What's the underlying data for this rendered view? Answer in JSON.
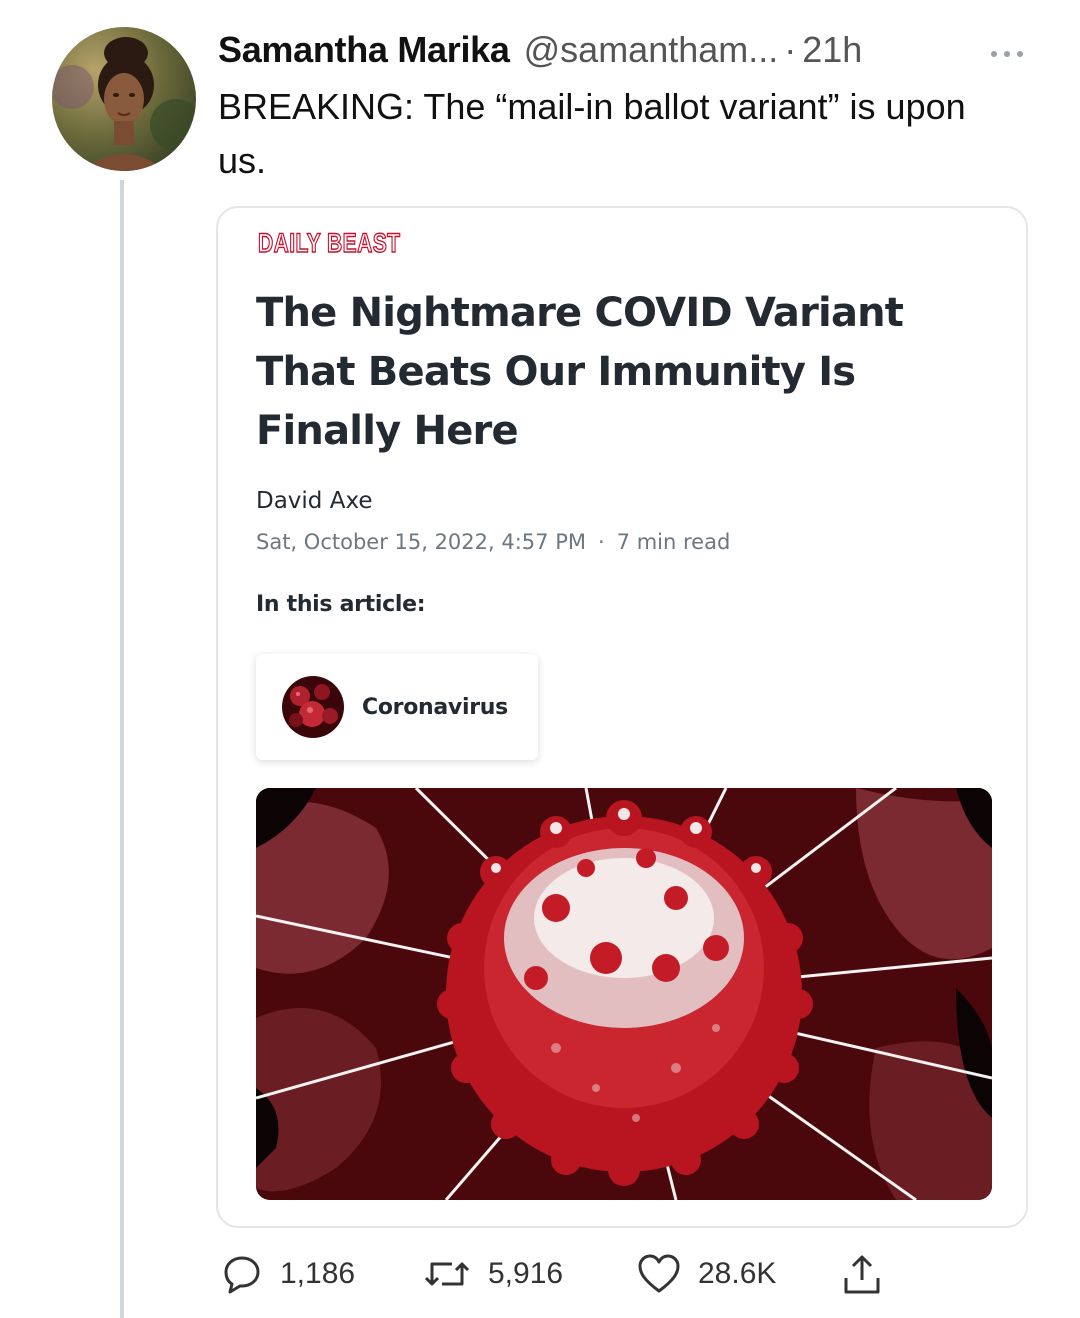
{
  "tweet": {
    "author_name": "Samantha Marika",
    "handle": "@samantham...",
    "separator": "·",
    "time": "21h",
    "more_icon": "more-dots-icon",
    "text": "BREAKING: The “mail-in ballot variant” is upon us."
  },
  "card": {
    "brand": "DAILY BEAST",
    "headline": "The Nightmare COVID Variant That Beats Our Immunity Is Finally Here",
    "author": "David Axe",
    "date": "Sat, October 15, 2022, 4:57 PM",
    "meta_separator": "·",
    "read_time": "7 min read",
    "in_article_label": "In this article:",
    "topic": "Coronavirus",
    "brand_color": "#c8102e"
  },
  "actions": {
    "replies": "1,186",
    "retweets": "5,916",
    "likes": "28.6K",
    "reply_icon": "reply-icon",
    "retweet_icon": "retweet-icon",
    "like_icon": "heart-icon",
    "share_icon": "share-icon"
  }
}
